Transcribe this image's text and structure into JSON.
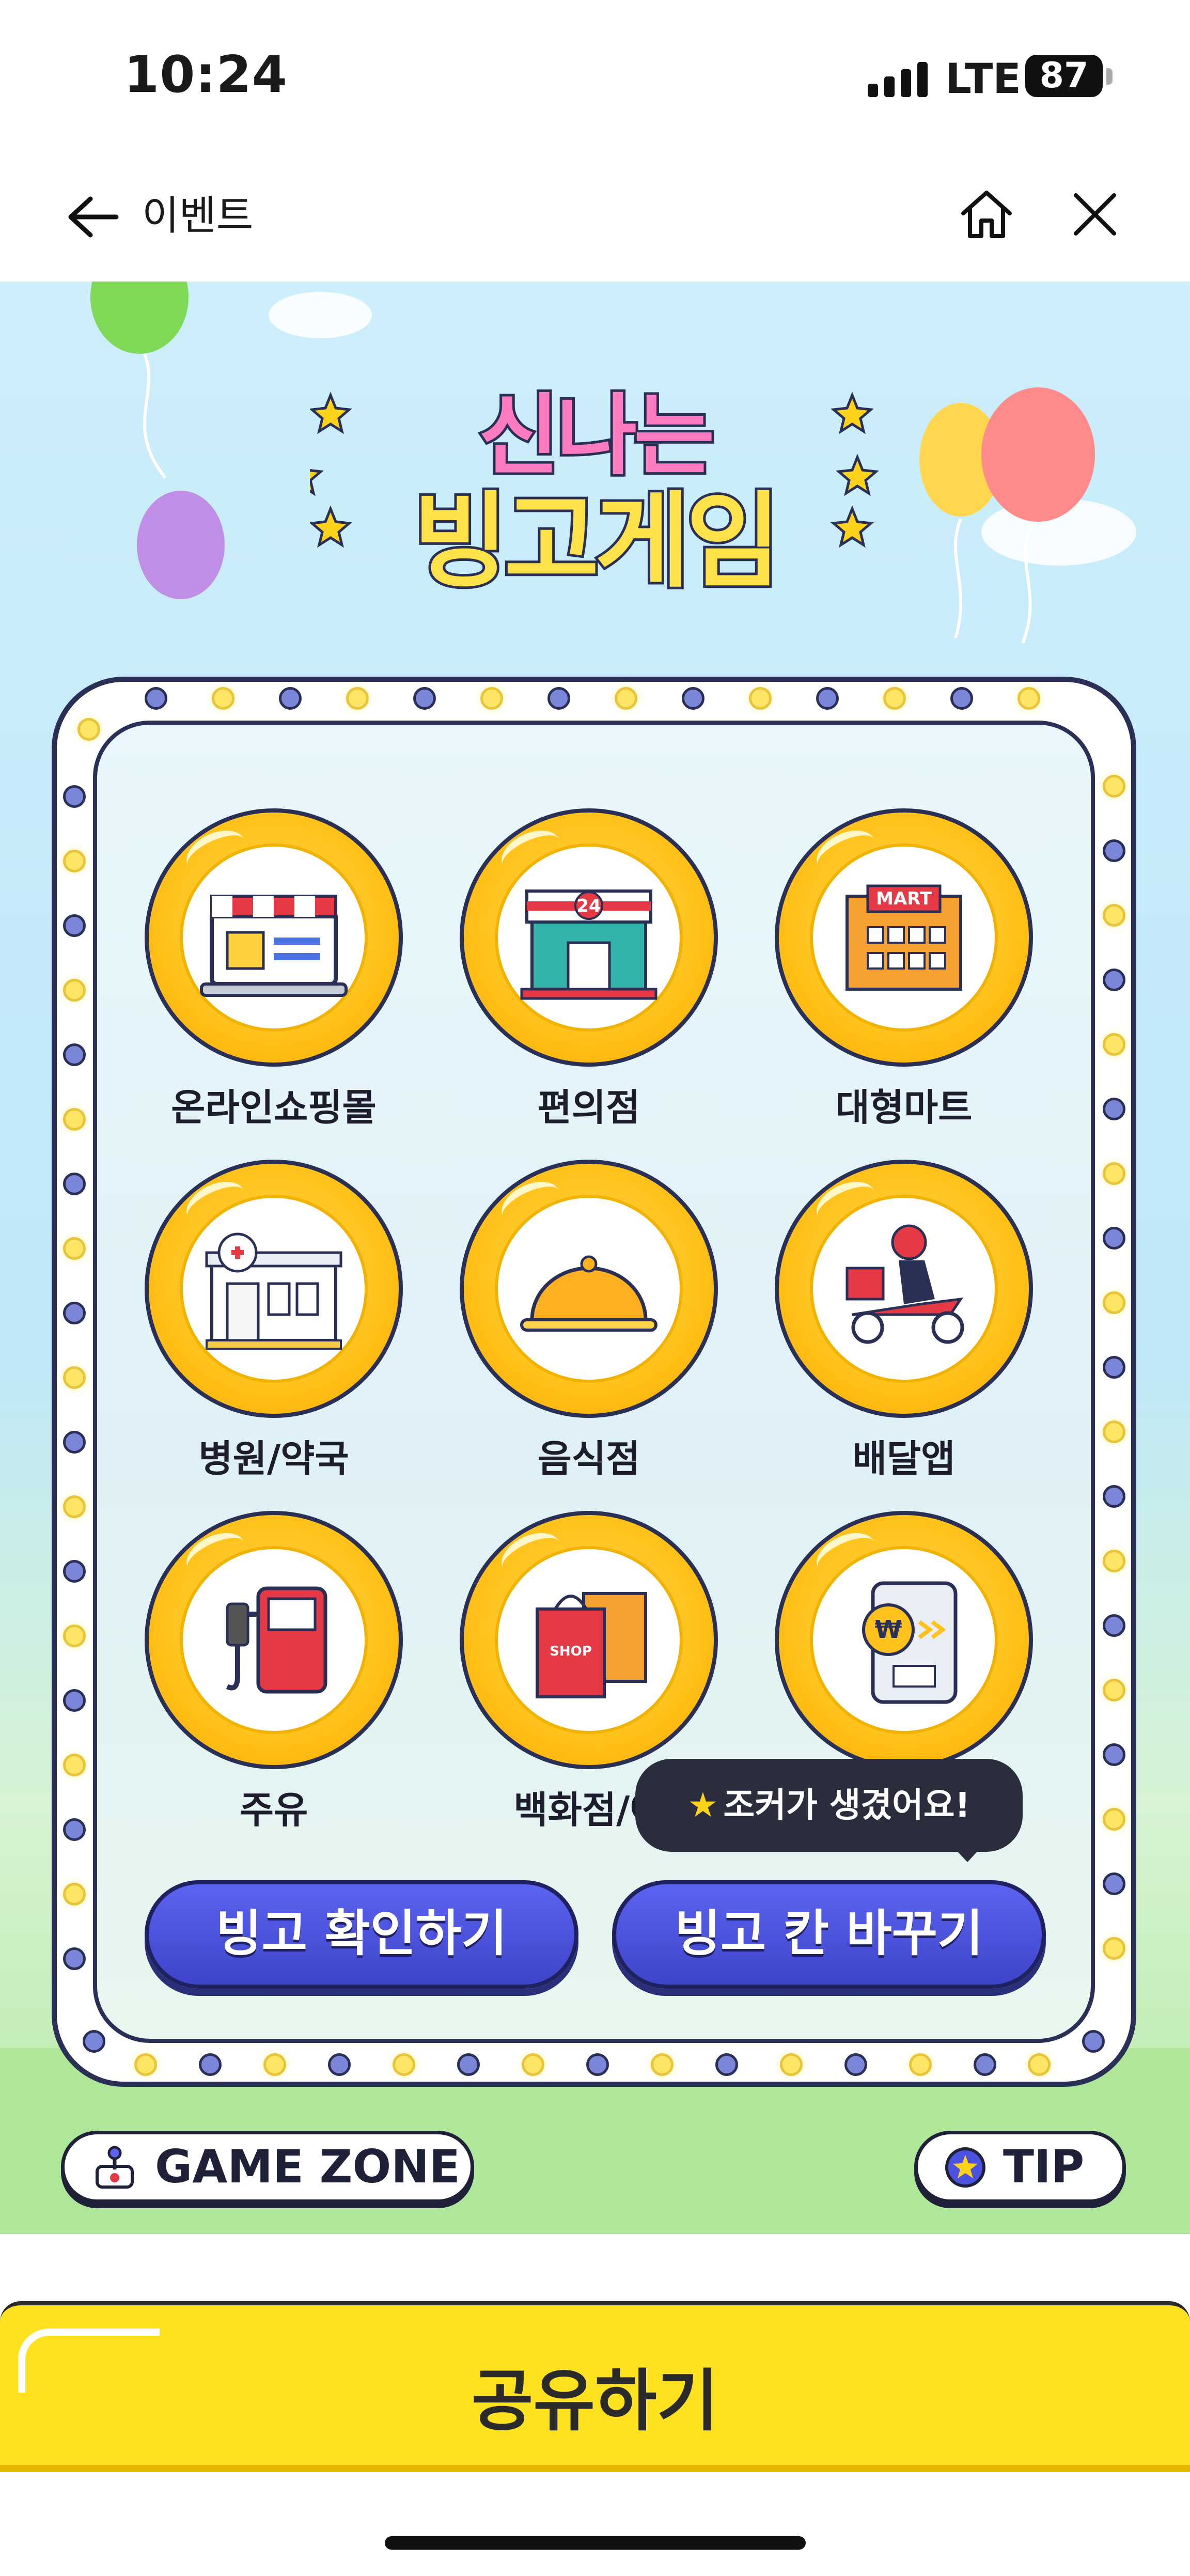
{
  "status_bar": {
    "time": "10:24",
    "network": "LTE",
    "battery": "87"
  },
  "nav": {
    "title": "이벤트"
  },
  "event": {
    "title_line1": "신나는",
    "title_line2": "빙고게임",
    "bingo_cells": [
      {
        "label": "온라인쇼핑몰",
        "icon": "online-shop-icon"
      },
      {
        "label": "편의점",
        "icon": "convenience-store-icon"
      },
      {
        "label": "대형마트",
        "icon": "mart-icon"
      },
      {
        "label": "병원/약국",
        "icon": "hospital-icon"
      },
      {
        "label": "음식점",
        "icon": "restaurant-cloche-icon"
      },
      {
        "label": "배달앱",
        "icon": "delivery-scooter-icon"
      },
      {
        "label": "주유",
        "icon": "gas-pump-icon"
      },
      {
        "label": "백화점/아",
        "icon": "shopping-bag-icon"
      },
      {
        "label": "",
        "icon": "mobile-payment-icon"
      }
    ],
    "icon_text": {
      "store_24": "24",
      "mart": "MART",
      "shop": "SHOP",
      "won": "₩"
    },
    "tooltip": "조커가 생겼어요!",
    "check_bingo_button": "빙고 확인하기",
    "change_cell_button": "빙고 칸 바꾸기",
    "game_zone": "GAME ZONE",
    "tip": "TIP"
  },
  "share_button": "공유하기",
  "colors": {
    "accent_yellow": "#ffe21f",
    "button_blue": "#4a52e0",
    "coin_gold": "#ffc21a"
  }
}
